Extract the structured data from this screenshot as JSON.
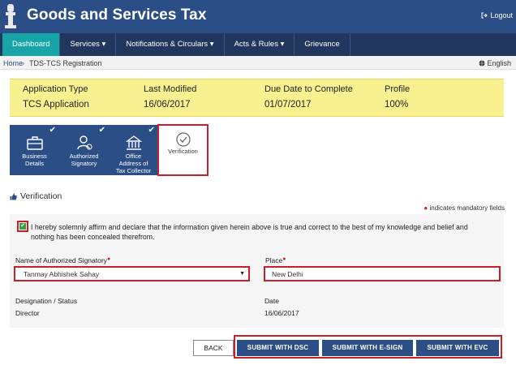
{
  "header": {
    "title": "Goods and Services Tax",
    "logout_label": "Logout"
  },
  "nav": {
    "items": [
      "Dashboard",
      "Services ▾",
      "Notifications & Circulars ▾",
      "Acts & Rules ▾",
      "Grievance"
    ]
  },
  "breadcrumb": {
    "home": "Home",
    "separator": "›",
    "current": "TDS-TCS Registration",
    "language": "English"
  },
  "summary": {
    "application_type_label": "Application Type",
    "application_type_value": "TCS Application",
    "last_modified_label": "Last Modified",
    "last_modified_value": "16/06/2017",
    "due_date_label": "Due Date to Complete",
    "due_date_value": "01/07/2017",
    "profile_label": "Profile",
    "profile_value": "100%"
  },
  "tabs": [
    {
      "label_1": "Business",
      "label_2": "Details",
      "label_3": "",
      "completed": true
    },
    {
      "label_1": "Authorized",
      "label_2": "Signatory",
      "label_3": "",
      "completed": true
    },
    {
      "label_1": "Office",
      "label_2": "Address of",
      "label_3": "Tax Collector",
      "completed": true
    },
    {
      "label_1": "Verification",
      "label_2": "",
      "label_3": "",
      "completed": false
    }
  ],
  "section": {
    "title": "Verification",
    "mandatory_note": "indicates mandatory fields"
  },
  "declaration": {
    "checked": true,
    "text": "I hereby solemnly affirm and declare that the information given herein above is true and correct to the best of my knowledge and belief and nothing has been concealed therefrom."
  },
  "form": {
    "signatory_label": "Name of Authorized Signatory",
    "signatory_value": "Tanmay Abhishek Sahay",
    "place_label": "Place",
    "place_value": "New Delhi",
    "designation_label": "Designation / Status",
    "designation_value": "Director",
    "date_label": "Date",
    "date_value": "16/06/2017"
  },
  "buttons": {
    "back": "BACK",
    "submit_dsc": "SUBMIT WITH DSC",
    "submit_esign": "SUBMIT WITH E-SIGN",
    "submit_evc": "SUBMIT WITH EVC"
  },
  "colors": {
    "header": "#2c4e86",
    "nav": "#22375d",
    "nav_active": "#18a5a7",
    "summary_bg": "#f9f08f",
    "highlight": "#c8202a"
  }
}
